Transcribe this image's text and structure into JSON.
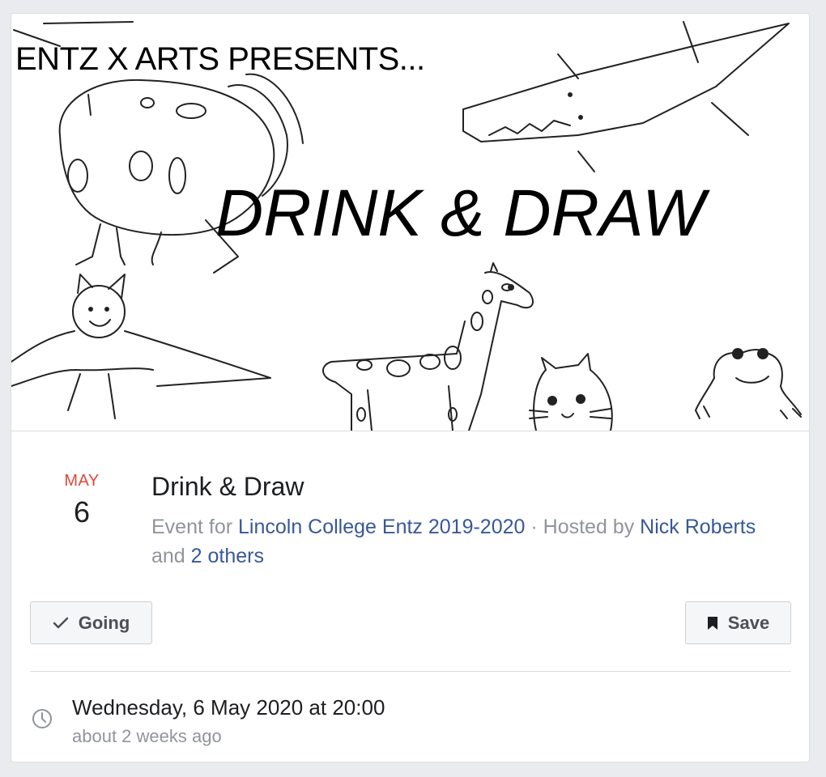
{
  "cover": {
    "presents_text": "ENTZ X ARTS PRESENTS...",
    "title_text": "DRINK & DRAW"
  },
  "event": {
    "month": "MAY",
    "day": "6",
    "title": "Drink & Draw",
    "meta": {
      "prefix": "Event for ",
      "group": "Lincoln College Entz 2019-2020",
      "sep": " · Hosted by ",
      "host": "Nick Roberts",
      "and": " and ",
      "others": "2 others"
    }
  },
  "actions": {
    "going_label": "Going",
    "save_label": "Save"
  },
  "details": {
    "datetime": "Wednesday, 6 May 2020 at 20:00",
    "relative": "about 2 weeks ago"
  },
  "colors": {
    "month_red": "#e0473b",
    "link_blue": "#385898",
    "muted_gray": "#90949c"
  },
  "icons": [
    "checkmark-icon",
    "bookmark-icon",
    "clock-icon"
  ]
}
